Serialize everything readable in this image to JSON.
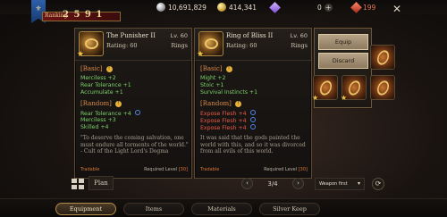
{
  "header": {
    "rank_label": "Ranking",
    "rank_value": "2 5 9 1",
    "banner_glyph": "⚜",
    "currencies": [
      {
        "icon": "silver-coin-icon",
        "value": "10,691,829"
      },
      {
        "icon": "gold-coin-icon",
        "value": "414,341"
      },
      {
        "icon": "gem-icon",
        "value": "0"
      },
      {
        "icon": "ruby-icon",
        "value": "199"
      }
    ],
    "close_label": "✕"
  },
  "left_item": {
    "name": "The Punisher II",
    "level": "Lv. 60",
    "rating": "Rating: 60",
    "type": "Rings",
    "basic_title": "[Basic]",
    "basic_stats": [
      "Merciless +2",
      "Rear Tolerance +1",
      "Accumulate +1"
    ],
    "random_title": "[Random]",
    "random_stats": [
      "Rear Tolerance +4",
      "Merciless +3",
      "Skilled +4"
    ],
    "lore": "\"To deserve the coming salvation, one must endure all torments of the world.\" - Cult of the Light Lord's Dogma",
    "tradable": "Tradable",
    "required_label": "Required Level",
    "required_value": "[30]"
  },
  "right_item": {
    "name": "Ring of Bliss II",
    "level": "Lv. 60",
    "rating": "Rating: 60",
    "type": "Rings",
    "basic_title": "[Basic]",
    "basic_stats": [
      "Might +2",
      "Stoic +1",
      "Survival Instincts +1"
    ],
    "random_title": "[Random]",
    "random_stats": [
      "Expose Flesh +4",
      "Expose Flesh +4",
      "Expose Flesh +4"
    ],
    "lore": "It was said that the gods painted the world with this, and so it was divorced from all evils of this world.",
    "tradable": "Tradable",
    "required_label": "Required Level",
    "required_value": "[30]"
  },
  "actions": {
    "equip": "Equip",
    "discard": "Discard"
  },
  "footer": {
    "plan_label": "Plan",
    "page_indicator": "3/4",
    "prev_label": "‹",
    "next_label": "›",
    "sort_label": "Weapon first",
    "sort_chevron": "▾",
    "refresh_label": "⟳"
  },
  "tabs": [
    "Equipment",
    "Items",
    "Materials",
    "Silver Keep"
  ],
  "active_tab": "Equipment"
}
